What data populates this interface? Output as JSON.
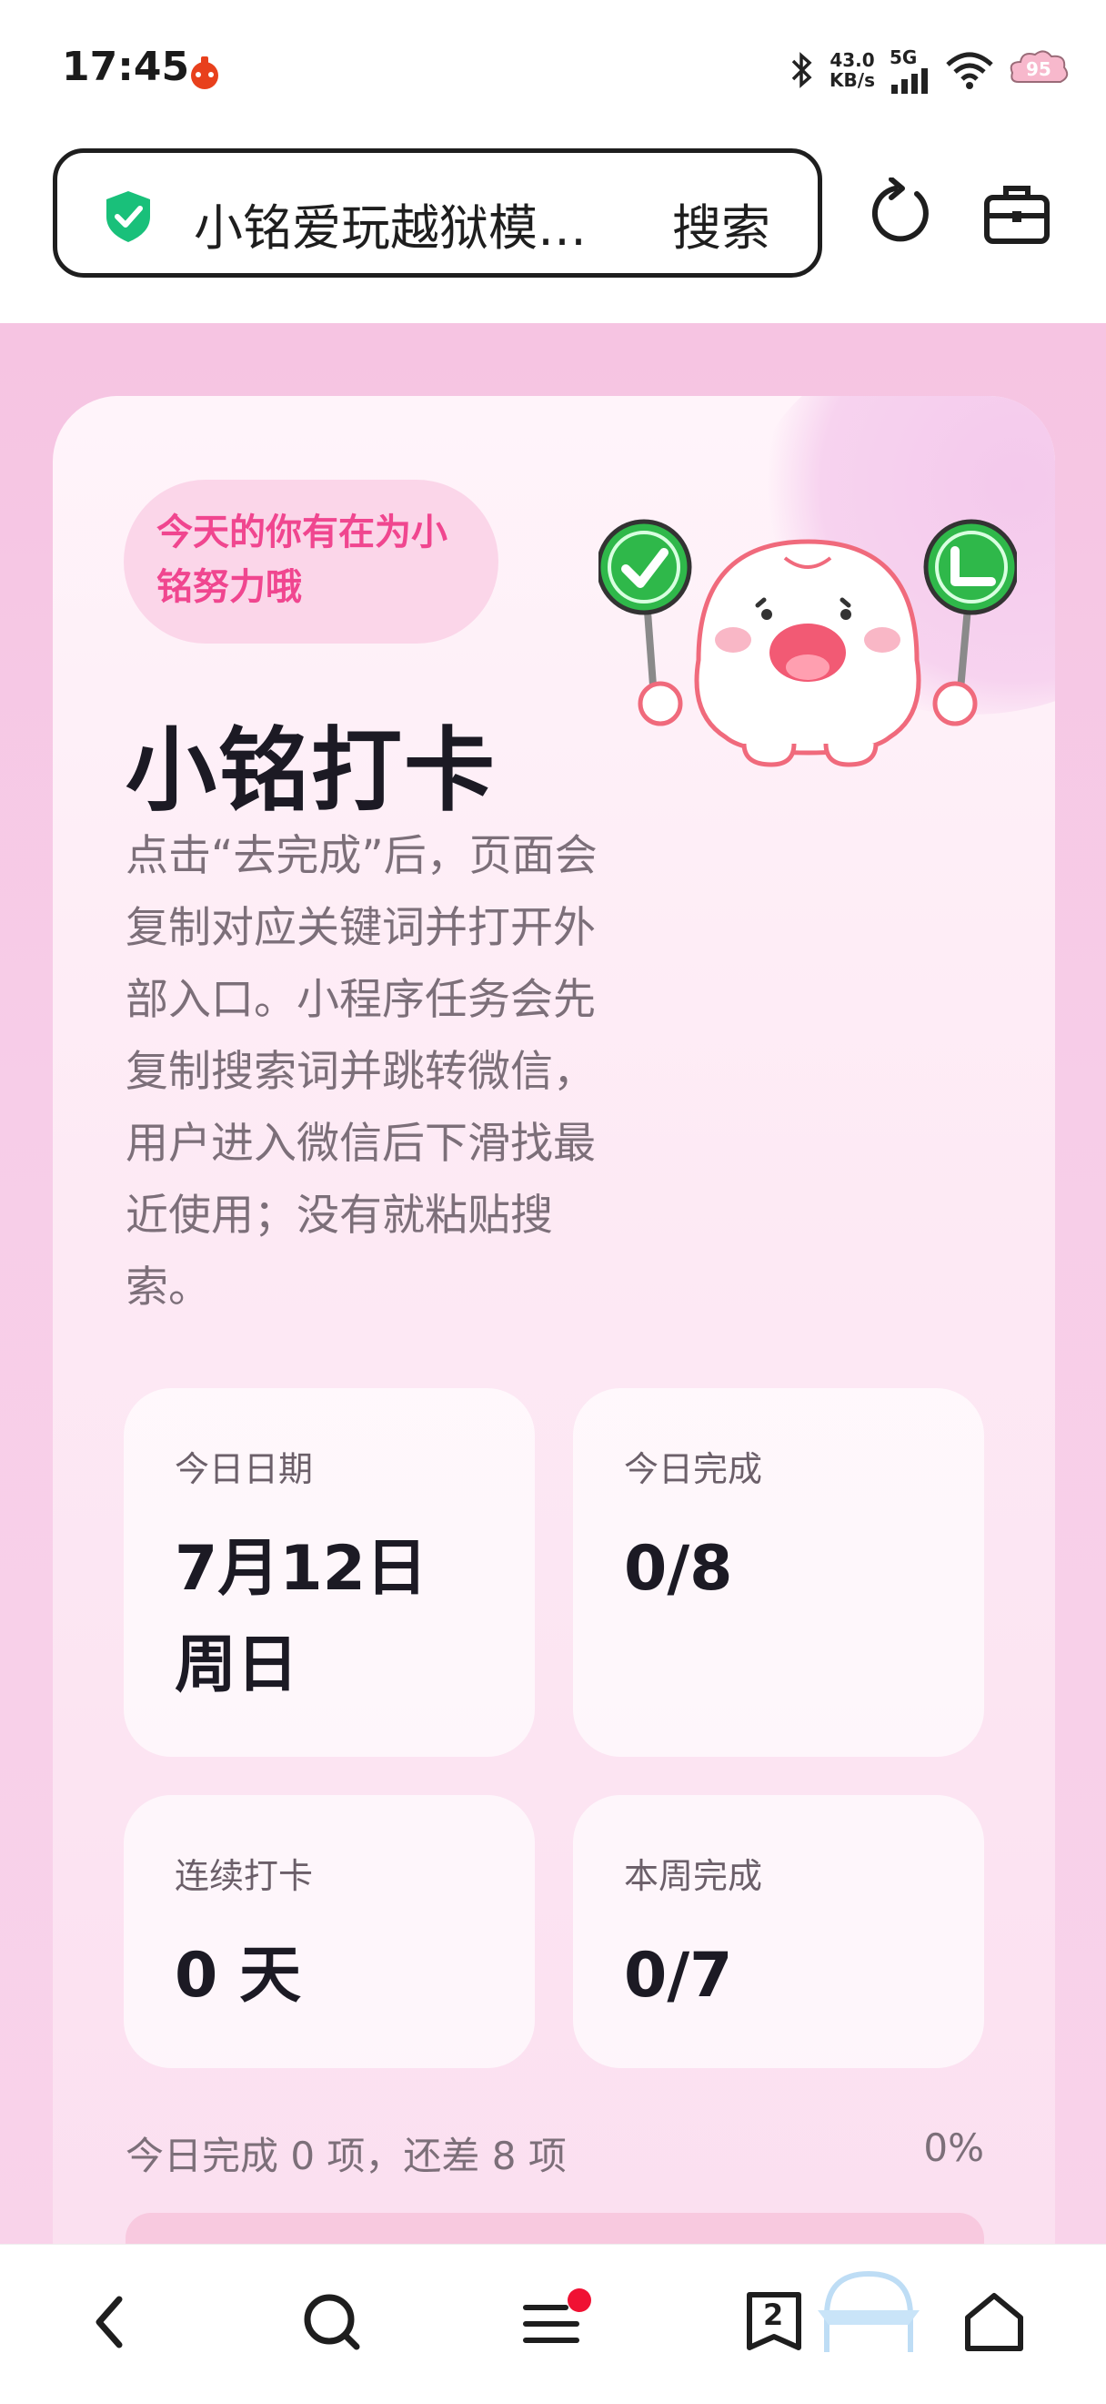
{
  "status_bar": {
    "time": "17:45",
    "net_speed_value": "43.0",
    "net_speed_unit": "KB/s",
    "network": "5G",
    "battery": "95",
    "icons": [
      "app-notification-icon",
      "bluetooth-icon",
      "signal-icon",
      "wifi-icon",
      "battery-icon"
    ]
  },
  "browser": {
    "search_query": "小铭爱玩越狱模拟器",
    "search_button": "搜索",
    "icons": [
      "shield-icon",
      "refresh-icon",
      "toolbox-icon"
    ]
  },
  "card": {
    "tag": "今天的你有在为小铭努力哦",
    "title": "小铭打卡",
    "description": "点击“去完成”后，页面会复制对应关键词并打开外部入口。小程序任务会先复制搜索词并跳转微信，用户进入微信后下滑找最近使用；没有就粘贴搜索。",
    "stats": [
      {
        "label": "今日日期",
        "value_line1": "7月12日",
        "value_line2": "周日"
      },
      {
        "label": "今日完成",
        "value_line1": "0/8",
        "value_line2": ""
      },
      {
        "label": "连续打卡",
        "value_line1": "0 天",
        "value_line2": ""
      },
      {
        "label": "本周完成",
        "value_line1": "0/7",
        "value_line2": ""
      }
    ],
    "progress_summary": "今日完成 0 项，还差 8 项",
    "progress_percent": "0%",
    "progress_value": 0
  },
  "bottom_nav": {
    "tab_count": "2",
    "items": [
      "back-icon",
      "search-icon",
      "menu-icon",
      "tabs-icon",
      "home-icon"
    ]
  },
  "colors": {
    "accent_pink": "#f0468f",
    "page_background": "#f6c4e2",
    "check_green": "#2fb84a",
    "shield_green": "#19c07a"
  }
}
